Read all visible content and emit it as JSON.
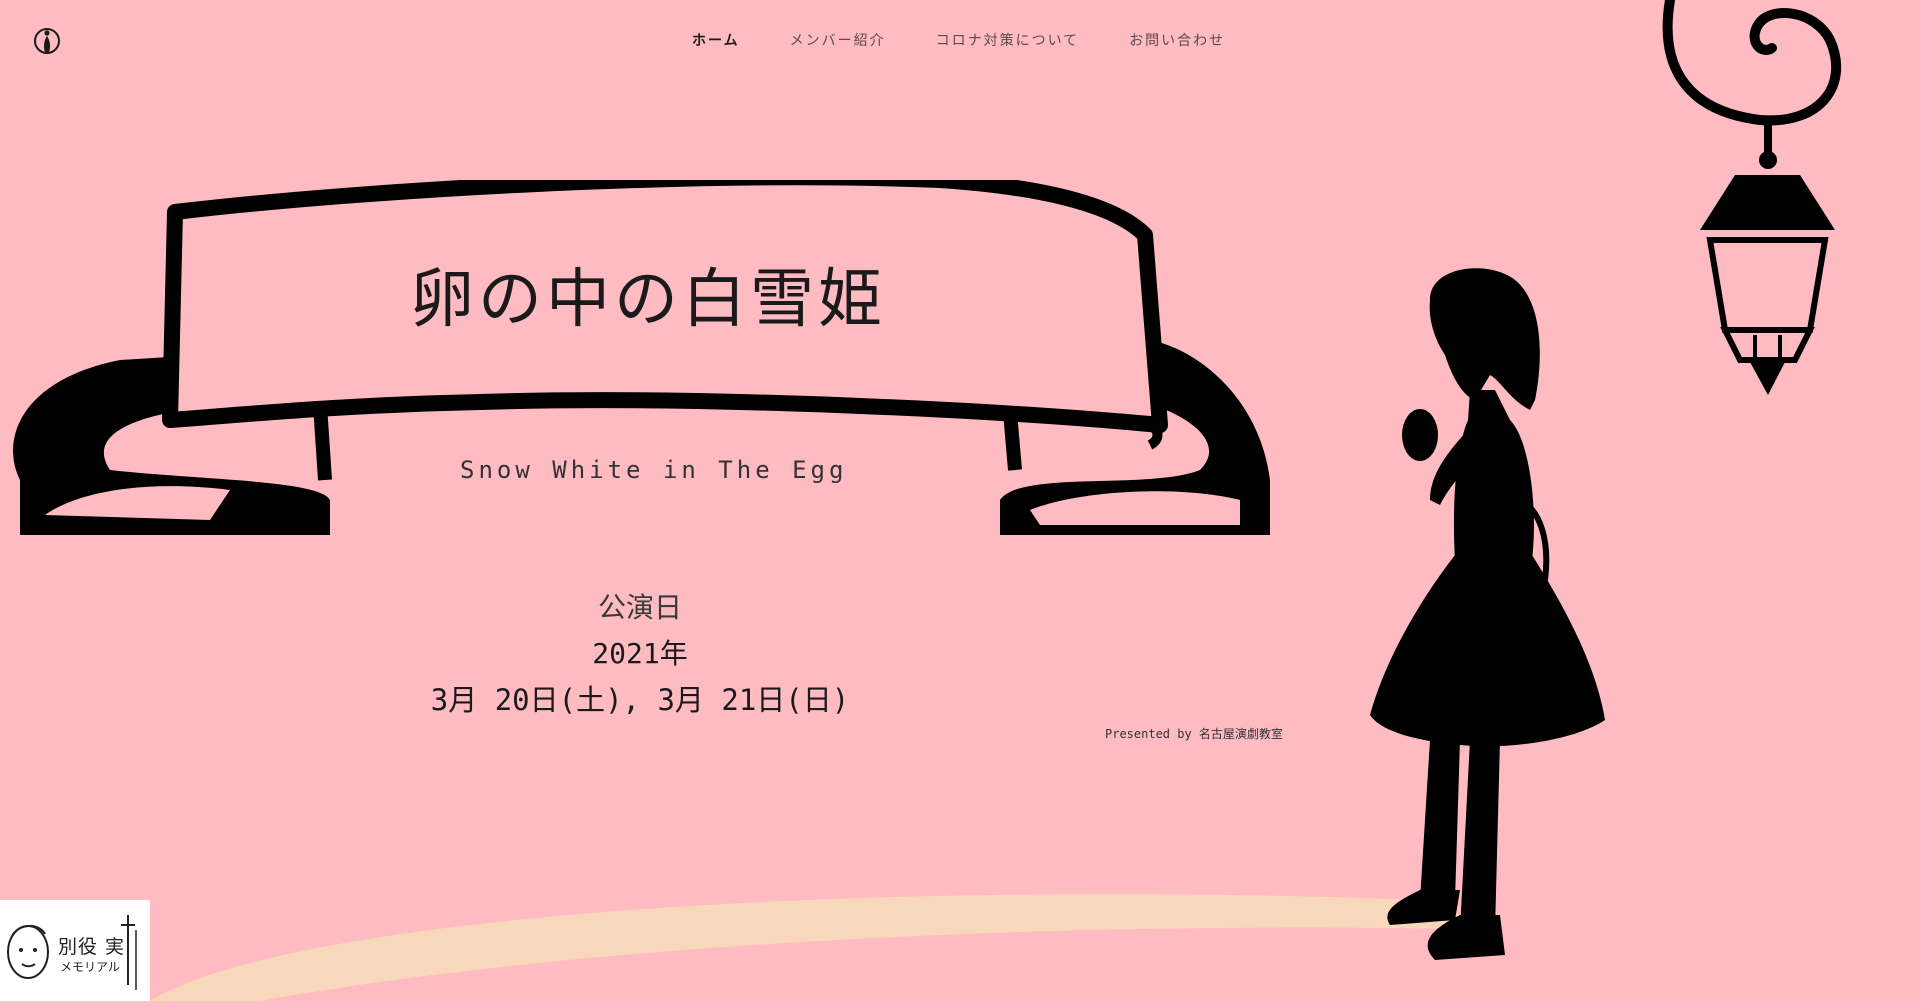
{
  "nav": {
    "items": [
      {
        "label": "ホーム"
      },
      {
        "label": "メンバー紹介"
      },
      {
        "label": "コロナ対策について"
      },
      {
        "label": "お問い合わせ"
      }
    ]
  },
  "hero": {
    "title": "卵の中の白雪姫",
    "subtitle": "Snow White in The Egg"
  },
  "schedule": {
    "label": "公演日",
    "year": "2021年",
    "dates": "3月 20日(土), 3月 21日(日)"
  },
  "presented": "Presented by 名古屋演劇教室",
  "badge": {
    "line1": "別役 実",
    "line2": "メモリアル"
  },
  "colors": {
    "background": "#ffbbc2",
    "ink": "#000000",
    "path": "#f7d8bb"
  },
  "icons": {
    "logo": "figure-logo-icon"
  }
}
